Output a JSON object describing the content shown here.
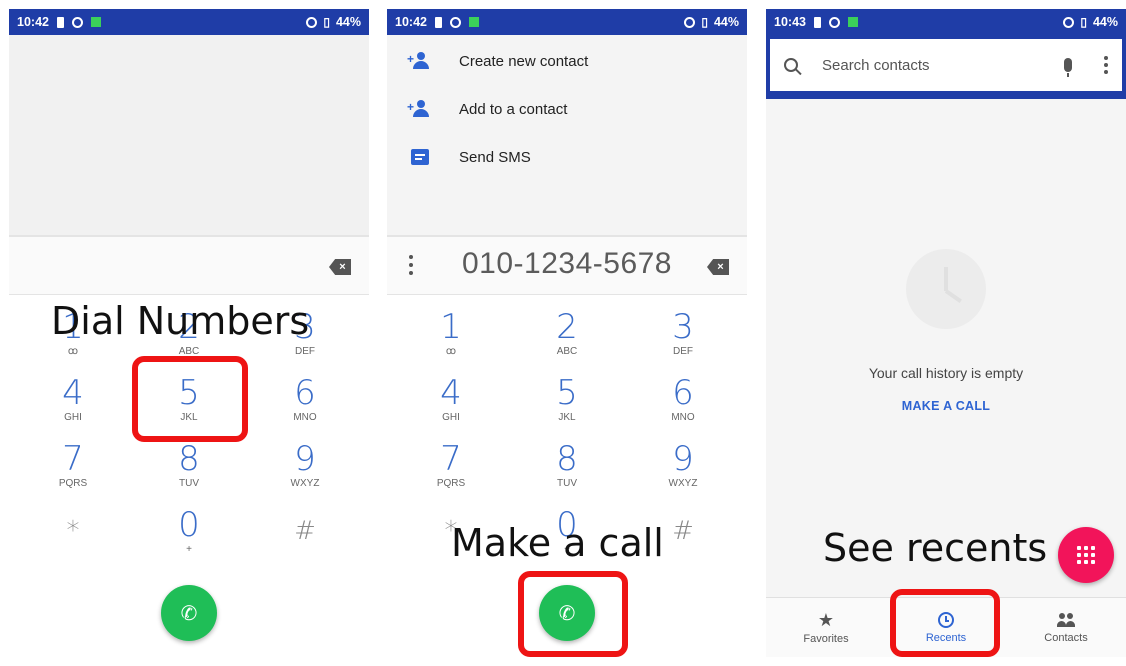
{
  "phones": [
    {
      "status": {
        "time": "10:42",
        "battery": "44%"
      },
      "overlay": "Dial Numbers",
      "number": "",
      "keys": [
        {
          "digit": "1",
          "letters": "ꝏ"
        },
        {
          "digit": "2",
          "letters": "ABC"
        },
        {
          "digit": "3",
          "letters": "DEF"
        },
        {
          "digit": "4",
          "letters": "GHI"
        },
        {
          "digit": "5",
          "letters": "JKL"
        },
        {
          "digit": "6",
          "letters": "MNO"
        },
        {
          "digit": "7",
          "letters": "PQRS"
        },
        {
          "digit": "8",
          "letters": "TUV"
        },
        {
          "digit": "9",
          "letters": "WXYZ"
        },
        {
          "digit": "*",
          "letters": ""
        },
        {
          "digit": "0",
          "letters": "+"
        },
        {
          "digit": "#",
          "letters": ""
        }
      ]
    },
    {
      "status": {
        "time": "10:42",
        "battery": "44%"
      },
      "overlay": "Make a call",
      "number": "010-1234-5678",
      "menu": [
        "Create new contact",
        "Add to a contact",
        "Send SMS"
      ],
      "keys": [
        {
          "digit": "1",
          "letters": "ꝏ"
        },
        {
          "digit": "2",
          "letters": "ABC"
        },
        {
          "digit": "3",
          "letters": "DEF"
        },
        {
          "digit": "4",
          "letters": "GHI"
        },
        {
          "digit": "5",
          "letters": "JKL"
        },
        {
          "digit": "6",
          "letters": "MNO"
        },
        {
          "digit": "7",
          "letters": "PQRS"
        },
        {
          "digit": "8",
          "letters": "TUV"
        },
        {
          "digit": "9",
          "letters": "WXYZ"
        },
        {
          "digit": "*",
          "letters": ""
        },
        {
          "digit": "0",
          "letters": "+"
        },
        {
          "digit": "#",
          "letters": ""
        }
      ]
    },
    {
      "status": {
        "time": "10:43",
        "battery": "44%"
      },
      "overlay": "See recents",
      "search": {
        "placeholder": "Search contacts"
      },
      "empty_text": "Your call history is empty",
      "make_call": "MAKE A CALL",
      "nav": [
        "Favorites",
        "Recents",
        "Contacts"
      ]
    }
  ],
  "colors": {
    "statusbar": "#1f3da7",
    "accent": "#2e64d2",
    "call_green": "#1fbe57",
    "highlight_red": "#ee1414",
    "fab_pink": "#f2145a"
  },
  "icons": {
    "status": [
      "sim-icon",
      "sync-icon",
      "notification-icon",
      "wifi-icon",
      "battery-icon"
    ],
    "menu": [
      "person-add-icon",
      "person-add-icon",
      "sms-icon"
    ],
    "dialer": [
      "backspace-icon",
      "overflow-icon",
      "phone-icon"
    ],
    "recents": [
      "search-icon",
      "mic-icon",
      "more-icon",
      "clock-icon",
      "dialpad-icon",
      "star-icon",
      "people-icon"
    ]
  }
}
